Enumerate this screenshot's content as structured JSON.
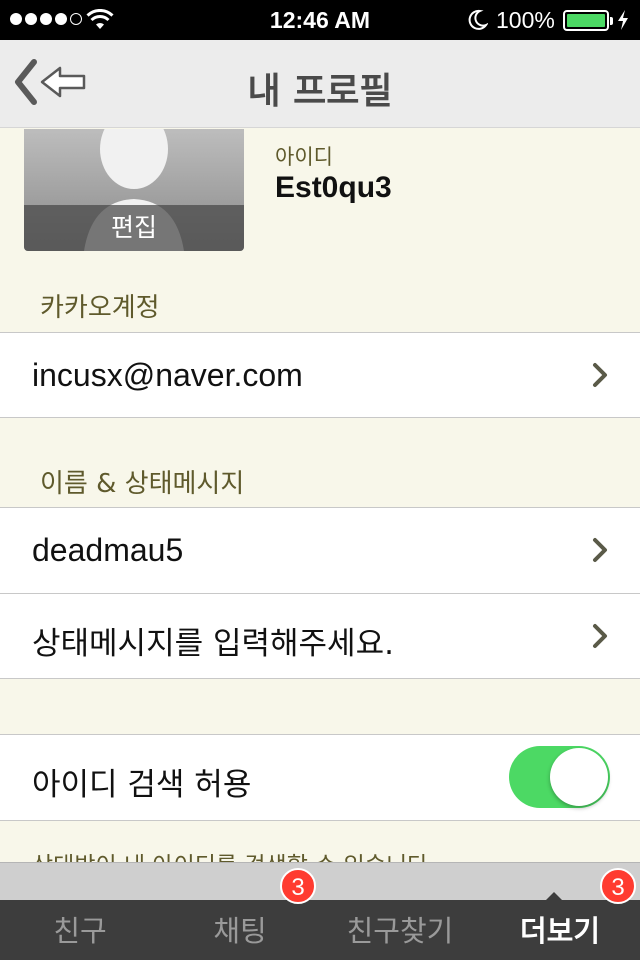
{
  "status_bar": {
    "time": "12:46 AM",
    "battery": "100%",
    "signal_filled": 4,
    "signal_total": 5,
    "battery_color": "#4cd964"
  },
  "nav": {
    "title": "내 프로필",
    "back_icon": "back-arrow-icon"
  },
  "profile": {
    "edit_label": "편집",
    "id_label": "아이디",
    "id_value": "Est0qu3"
  },
  "kakao_section": {
    "header": "카카오계정",
    "email": "incusx@naver.com"
  },
  "name_section": {
    "header": "이름 & 상태메시지",
    "name": "deadmau5",
    "status_placeholder": "상태메시지를 입력해주세요."
  },
  "search_setting": {
    "label": "아이디 검색 허용",
    "enabled": true,
    "helper": "상대방이 내 아이디를 검색할 수 있습니다."
  },
  "tabs": [
    {
      "label": "친구",
      "badge": "",
      "active": false
    },
    {
      "label": "채팅",
      "badge": "3",
      "active": false
    },
    {
      "label": "친구찾기",
      "badge": "",
      "active": false
    },
    {
      "label": "더보기",
      "badge": "3",
      "active": true
    }
  ],
  "colors": {
    "toggle_on": "#4cd964",
    "badge": "#ff3b30",
    "section_text": "#5f5a2c",
    "background": "#f8f7ea",
    "tab_bar": "#3d3d3d"
  }
}
